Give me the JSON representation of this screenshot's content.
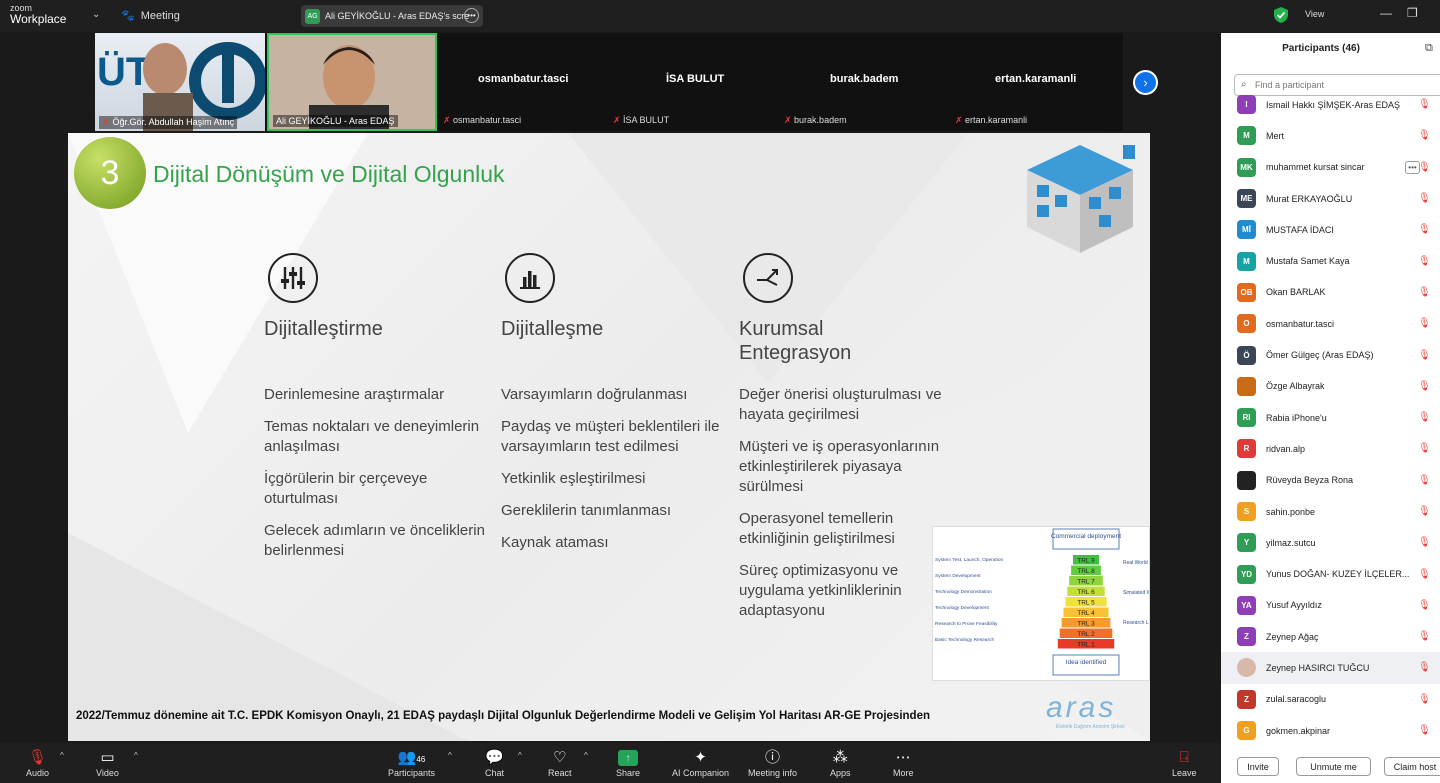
{
  "app": {
    "logo_small": "zoom",
    "logo_main": "Workplace",
    "meeting_label": "Meeting"
  },
  "share_tab": {
    "badge": "AG",
    "title": "Ali GEYİKOĞLU - Aras EDAŞ's scre"
  },
  "header": {
    "view_label": "View"
  },
  "video_strip": {
    "tiles": [
      {
        "label": "Öğr.Gör. Abdullah Haşim Atınç"
      },
      {
        "label": "Ali GEYİKOĞLU - Aras EDAŞ"
      }
    ],
    "names": [
      {
        "big": "osmanbatur.tasci",
        "small": "osmanbatur.tasci"
      },
      {
        "big": "İSA BULUT",
        "small": "İSA BULUT"
      },
      {
        "big": "burak.badem",
        "small": "burak.badem"
      },
      {
        "big": "ertan.karamanli",
        "small": "ertan.karamanli"
      }
    ]
  },
  "slide": {
    "number": "3",
    "title": "Dijital Dönüşüm ve Dijital Olgunluk",
    "columns": [
      {
        "heading": "Dijitalleştirme",
        "icon": "sliders-icon",
        "items": [
          "Derinlemesine araştırmalar",
          "Temas noktaları ve deneyimlerin anlaşılması",
          "İçgörülerin bir çerçeveye oturtulması",
          "Gelecek adımların ve önceliklerin belirlenmesi"
        ]
      },
      {
        "heading": "Dijitalleşme",
        "icon": "bar-chart-icon",
        "items": [
          "Varsayımların doğrulanması",
          "Paydaş ve müşteri beklentileri ile varsayımların test edilmesi",
          "Yetkinlik eşleştirilmesi",
          "Gereklilerin tanımlanması",
          "Kaynak ataması"
        ]
      },
      {
        "heading": "Kurumsal Entegrasyon",
        "icon": "arrows-split-icon",
        "items": [
          "Değer önerisi oluşturulması ve hayata geçirilmesi",
          "Müşteri ve iş operasyonlarının etkinleştirilerek piyasaya sürülmesi",
          "Operasyonel temellerin etkinliğinin geliştirilmesi",
          "Süreç optimizasyonu ve uygulama yetkinliklerinin adaptasyonu"
        ]
      }
    ],
    "trl": {
      "top": "Commercial deployment",
      "bottom": "Idea identified",
      "levels": [
        "TRL 9",
        "TRL 8",
        "TRL 7",
        "TRL 6",
        "TRL 5",
        "TRL 4",
        "TRL 3",
        "TRL 2",
        "TRL 1"
      ],
      "colors": [
        "#3fbf3f",
        "#5fcb3f",
        "#8fd43f",
        "#c4df3c",
        "#f0e23a",
        "#f7c234",
        "#f59a2e",
        "#f0702a",
        "#e83a26"
      ],
      "left_labels": [
        "System Test, Launch, Operation",
        "System Development",
        "Technology Demonstration",
        "Technology Development",
        "Research to Prove Feasibility",
        "Basic Technology Research"
      ],
      "right_labels": [
        "Real World",
        "Simulated World",
        "Research Lab"
      ]
    },
    "footer": "2022/Temmuz dönemine ait T.C. EPDK Komisyon Onaylı, 21 EDAŞ paydaşlı Dijital Olgunluk Değerlendirme Modeli ve Gelişim Yol Haritası AR-GE Projesinden",
    "brand": "aras",
    "brand_sub": "Elektrik Dağıtım Anonim Şirketi"
  },
  "participants": {
    "title": "Participants (46)",
    "search_placeholder": "Find a participant",
    "list": [
      {
        "initials": "I",
        "name": "Ismail Hakkı ŞİMŞEK-Aras EDAŞ",
        "color": "#8e3fb6"
      },
      {
        "initials": "M",
        "name": "Mert",
        "color": "#2f9d55"
      },
      {
        "initials": "MK",
        "name": "muhammet kursat sincar",
        "color": "#2f9d55"
      },
      {
        "initials": "ME",
        "name": "Murat ERKAYAOĞLU",
        "color": "#3b4656"
      },
      {
        "initials": "Mİ",
        "name": "MUSTAFA İDACI",
        "color": "#1f8cd0"
      },
      {
        "initials": "M",
        "name": "Mustafa Samet Kaya",
        "color": "#16a3a3"
      },
      {
        "initials": "OB",
        "name": "Okan BARLAK",
        "color": "#e36a1c"
      },
      {
        "initials": "O",
        "name": "osmanbatur.tasci",
        "color": "#e36a1c"
      },
      {
        "initials": "Ö",
        "name": "Ömer Gülgeç (Aras EDAŞ)",
        "color": "#3b4656"
      },
      {
        "initials": "",
        "name": "Özge Albayrak",
        "color": "#c96a14"
      },
      {
        "initials": "RI",
        "name": "Rabia iPhone'u",
        "color": "#2f9d55"
      },
      {
        "initials": "R",
        "name": "ridvan.alp",
        "color": "#e03a3a"
      },
      {
        "initials": "",
        "name": "Rüveyda Beyza Rona",
        "color": "#222222"
      },
      {
        "initials": "S",
        "name": "sahin.ponbe",
        "color": "#f0a020"
      },
      {
        "initials": "Y",
        "name": "yilmaz.sutcu",
        "color": "#2f9d55"
      },
      {
        "initials": "YD",
        "name": "Yunus DOĞAN- KUZEY İLÇELER...",
        "color": "#2f9d55"
      },
      {
        "initials": "YA",
        "name": "Yusuf Ayyıldız",
        "color": "#8e3fb6"
      },
      {
        "initials": "Z",
        "name": "Zeynep Ağaç",
        "color": "#8e3fb6"
      },
      {
        "initials": "",
        "name": "Zeynep HASIRCI TUĞCU",
        "color": "#d8b8a8"
      },
      {
        "initials": "Z",
        "name": "zulal.saracoglu",
        "color": "#c0392b"
      },
      {
        "initials": "G",
        "name": "gokmen.akpinar",
        "color": "#f0a020"
      }
    ],
    "buttons": {
      "invite": "Invite",
      "unmute": "Unmute me",
      "claim": "Claim host"
    }
  },
  "toolbar": {
    "audio": "Audio",
    "video": "Video",
    "participants": "Participants",
    "participants_count": "46",
    "chat": "Chat",
    "react": "React",
    "share": "Share",
    "ai": "AI Companion",
    "info": "Meeting info",
    "apps": "Apps",
    "more": "More",
    "leave": "Leave"
  }
}
